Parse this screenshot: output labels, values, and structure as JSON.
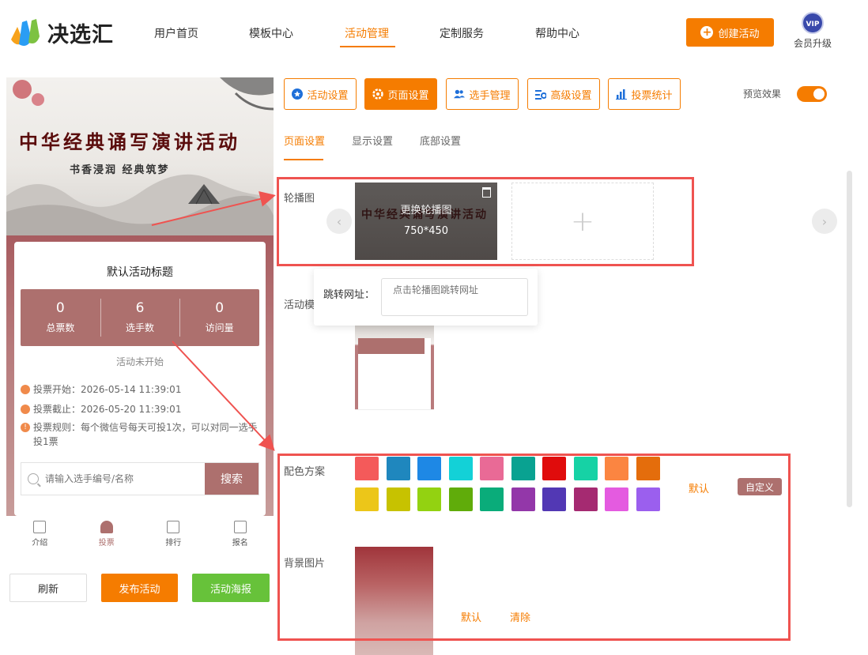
{
  "header": {
    "logo_text": "决选汇",
    "nav": [
      "用户首页",
      "模板中心",
      "活动管理",
      "定制服务",
      "帮助中心"
    ],
    "active_nav": "活动管理",
    "create_label": "创建活动",
    "vip_badge": "VIP",
    "vip_label": "会员升级"
  },
  "preview": {
    "banner_title": "中华经典诵写演讲活动",
    "banner_sub": "书香浸润  经典筑梦",
    "card_title": "默认活动标题",
    "stats": [
      {
        "value": "0",
        "label": "总票数"
      },
      {
        "value": "6",
        "label": "选手数"
      },
      {
        "value": "0",
        "label": "访问量"
      }
    ],
    "status": "活动未开始",
    "info": [
      "投票开始：2026-05-14 11:39:01",
      "投票截止：2026-05-20 11:39:01",
      "投票规则：每个微信号每天可投1次，可以对同一选手投1票"
    ],
    "search_placeholder": "请输入选手编号/名称",
    "search_button": "搜索",
    "tabbar": [
      "介绍",
      "投票",
      "排行",
      "报名"
    ]
  },
  "bottom_buttons": {
    "refresh": "刷新",
    "publish": "发布活动",
    "poster": "活动海报"
  },
  "top_tabs": [
    "活动设置",
    "页面设置",
    "选手管理",
    "高级设置",
    "投票统计"
  ],
  "active_top_tab": "页面设置",
  "preview_toggle": {
    "label": "预览效果",
    "on": true
  },
  "sub_tabs": [
    "页面设置",
    "显示设置",
    "底部设置"
  ],
  "active_sub_tab": "页面设置",
  "carousel": {
    "label": "轮播图",
    "image_title": "中华经典诵写演讲活动",
    "change_text": "更换轮播图",
    "size_text": "750*450",
    "add_symbol": "+",
    "prev_arrow": "‹",
    "next_arrow": "›"
  },
  "jump_popover": {
    "label": "跳转网址：",
    "placeholder": "点击轮播图跳转网址"
  },
  "template": {
    "label": "活动模"
  },
  "color_scheme": {
    "label": "配色方案",
    "colors": [
      "#f45a5a",
      "#1f87be",
      "#1e88e5",
      "#13d1d7",
      "#e96a96",
      "#09a291",
      "#e00c0c",
      "#16d2a5",
      "#fb8541",
      "#e46d0c",
      "#ecc619",
      "#c7c200",
      "#93d211",
      "#60ac0a",
      "#0aac7a",
      "#9337a9",
      "#5238b4",
      "#a52a71",
      "#e45be0",
      "#9b5fee"
    ],
    "default_label": "默认",
    "custom_label": "自定义"
  },
  "background": {
    "label": "背景图片",
    "default_label": "默认",
    "clear_label": "清除"
  },
  "accent": "#f57c00",
  "theme": "#ad706e"
}
